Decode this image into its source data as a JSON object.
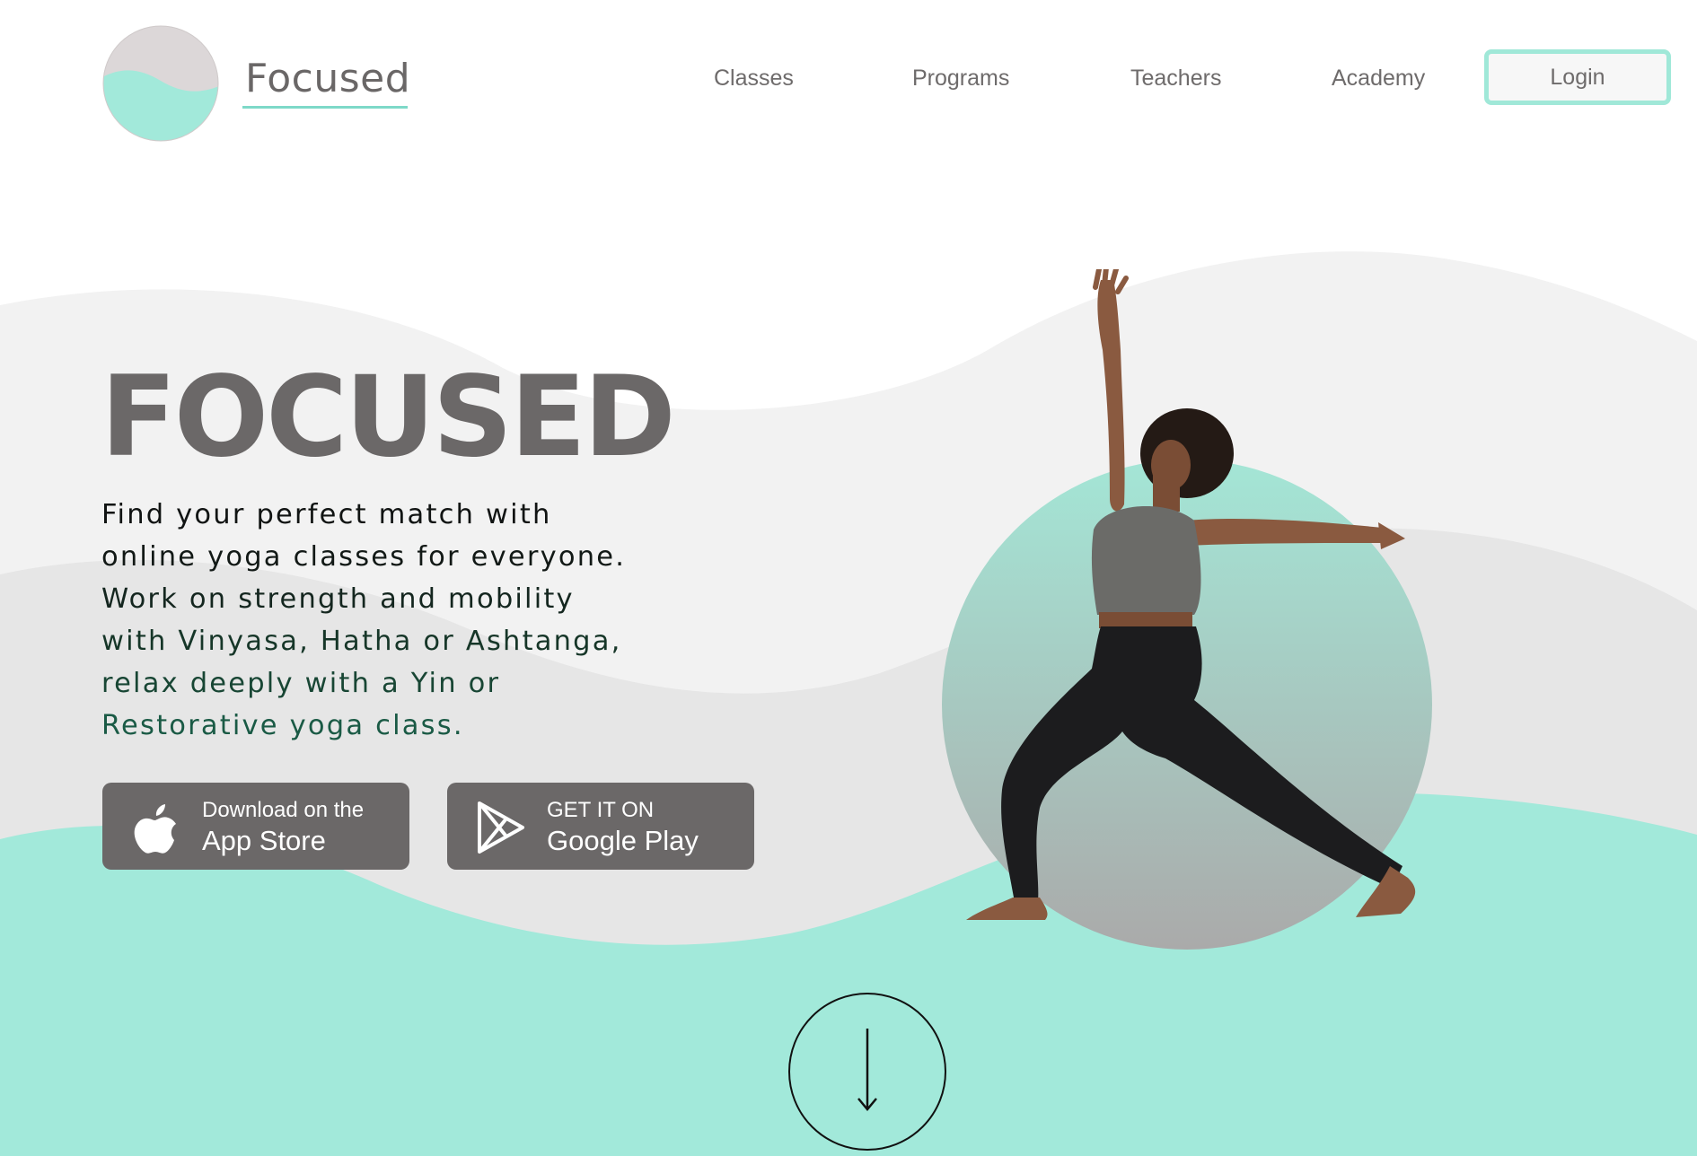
{
  "header": {
    "brand": "Focused",
    "nav": [
      {
        "label": "Classes"
      },
      {
        "label": "Programs"
      },
      {
        "label": "Teachers"
      },
      {
        "label": "Academy"
      }
    ],
    "login_label": "Login"
  },
  "hero": {
    "title": "FOCUSED",
    "lines": [
      "Find your perfect match with",
      "online yoga classes for everyone.",
      "Work on strength and mobility",
      "with Vinyasa, Hatha or Ashtanga,",
      "relax deeply with a Yin or",
      "Restorative yoga class."
    ]
  },
  "store_buttons": {
    "app_store": {
      "small": "Download on the",
      "big": "App Store",
      "icon": "apple-icon"
    },
    "google_play": {
      "small": "GET IT ON",
      "big": "Google Play",
      "icon": "play-store-icon"
    }
  },
  "scroll": {
    "icon": "arrow-down-icon"
  },
  "colors": {
    "accent": "#a2e9da",
    "text_gray": "#6b6868",
    "text_dark": "#111a17",
    "text_green": "#1a5a45",
    "wave_light": "#f2f2f2",
    "wave_mid": "#e6e6e6"
  }
}
